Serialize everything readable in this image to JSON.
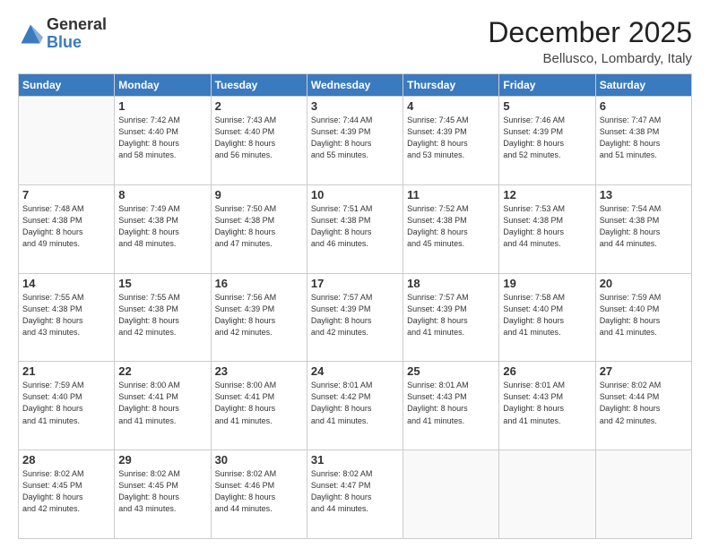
{
  "logo": {
    "general": "General",
    "blue": "Blue"
  },
  "header": {
    "month": "December 2025",
    "location": "Bellusco, Lombardy, Italy"
  },
  "weekdays": [
    "Sunday",
    "Monday",
    "Tuesday",
    "Wednesday",
    "Thursday",
    "Friday",
    "Saturday"
  ],
  "weeks": [
    [
      {
        "day": "",
        "info": ""
      },
      {
        "day": "1",
        "info": "Sunrise: 7:42 AM\nSunset: 4:40 PM\nDaylight: 8 hours\nand 58 minutes."
      },
      {
        "day": "2",
        "info": "Sunrise: 7:43 AM\nSunset: 4:40 PM\nDaylight: 8 hours\nand 56 minutes."
      },
      {
        "day": "3",
        "info": "Sunrise: 7:44 AM\nSunset: 4:39 PM\nDaylight: 8 hours\nand 55 minutes."
      },
      {
        "day": "4",
        "info": "Sunrise: 7:45 AM\nSunset: 4:39 PM\nDaylight: 8 hours\nand 53 minutes."
      },
      {
        "day": "5",
        "info": "Sunrise: 7:46 AM\nSunset: 4:39 PM\nDaylight: 8 hours\nand 52 minutes."
      },
      {
        "day": "6",
        "info": "Sunrise: 7:47 AM\nSunset: 4:38 PM\nDaylight: 8 hours\nand 51 minutes."
      }
    ],
    [
      {
        "day": "7",
        "info": "Sunrise: 7:48 AM\nSunset: 4:38 PM\nDaylight: 8 hours\nand 49 minutes."
      },
      {
        "day": "8",
        "info": "Sunrise: 7:49 AM\nSunset: 4:38 PM\nDaylight: 8 hours\nand 48 minutes."
      },
      {
        "day": "9",
        "info": "Sunrise: 7:50 AM\nSunset: 4:38 PM\nDaylight: 8 hours\nand 47 minutes."
      },
      {
        "day": "10",
        "info": "Sunrise: 7:51 AM\nSunset: 4:38 PM\nDaylight: 8 hours\nand 46 minutes."
      },
      {
        "day": "11",
        "info": "Sunrise: 7:52 AM\nSunset: 4:38 PM\nDaylight: 8 hours\nand 45 minutes."
      },
      {
        "day": "12",
        "info": "Sunrise: 7:53 AM\nSunset: 4:38 PM\nDaylight: 8 hours\nand 44 minutes."
      },
      {
        "day": "13",
        "info": "Sunrise: 7:54 AM\nSunset: 4:38 PM\nDaylight: 8 hours\nand 44 minutes."
      }
    ],
    [
      {
        "day": "14",
        "info": "Sunrise: 7:55 AM\nSunset: 4:38 PM\nDaylight: 8 hours\nand 43 minutes."
      },
      {
        "day": "15",
        "info": "Sunrise: 7:55 AM\nSunset: 4:38 PM\nDaylight: 8 hours\nand 42 minutes."
      },
      {
        "day": "16",
        "info": "Sunrise: 7:56 AM\nSunset: 4:39 PM\nDaylight: 8 hours\nand 42 minutes."
      },
      {
        "day": "17",
        "info": "Sunrise: 7:57 AM\nSunset: 4:39 PM\nDaylight: 8 hours\nand 42 minutes."
      },
      {
        "day": "18",
        "info": "Sunrise: 7:57 AM\nSunset: 4:39 PM\nDaylight: 8 hours\nand 41 minutes."
      },
      {
        "day": "19",
        "info": "Sunrise: 7:58 AM\nSunset: 4:40 PM\nDaylight: 8 hours\nand 41 minutes."
      },
      {
        "day": "20",
        "info": "Sunrise: 7:59 AM\nSunset: 4:40 PM\nDaylight: 8 hours\nand 41 minutes."
      }
    ],
    [
      {
        "day": "21",
        "info": "Sunrise: 7:59 AM\nSunset: 4:40 PM\nDaylight: 8 hours\nand 41 minutes."
      },
      {
        "day": "22",
        "info": "Sunrise: 8:00 AM\nSunset: 4:41 PM\nDaylight: 8 hours\nand 41 minutes."
      },
      {
        "day": "23",
        "info": "Sunrise: 8:00 AM\nSunset: 4:41 PM\nDaylight: 8 hours\nand 41 minutes."
      },
      {
        "day": "24",
        "info": "Sunrise: 8:01 AM\nSunset: 4:42 PM\nDaylight: 8 hours\nand 41 minutes."
      },
      {
        "day": "25",
        "info": "Sunrise: 8:01 AM\nSunset: 4:43 PM\nDaylight: 8 hours\nand 41 minutes."
      },
      {
        "day": "26",
        "info": "Sunrise: 8:01 AM\nSunset: 4:43 PM\nDaylight: 8 hours\nand 41 minutes."
      },
      {
        "day": "27",
        "info": "Sunrise: 8:02 AM\nSunset: 4:44 PM\nDaylight: 8 hours\nand 42 minutes."
      }
    ],
    [
      {
        "day": "28",
        "info": "Sunrise: 8:02 AM\nSunset: 4:45 PM\nDaylight: 8 hours\nand 42 minutes."
      },
      {
        "day": "29",
        "info": "Sunrise: 8:02 AM\nSunset: 4:45 PM\nDaylight: 8 hours\nand 43 minutes."
      },
      {
        "day": "30",
        "info": "Sunrise: 8:02 AM\nSunset: 4:46 PM\nDaylight: 8 hours\nand 44 minutes."
      },
      {
        "day": "31",
        "info": "Sunrise: 8:02 AM\nSunset: 4:47 PM\nDaylight: 8 hours\nand 44 minutes."
      },
      {
        "day": "",
        "info": ""
      },
      {
        "day": "",
        "info": ""
      },
      {
        "day": "",
        "info": ""
      }
    ]
  ]
}
